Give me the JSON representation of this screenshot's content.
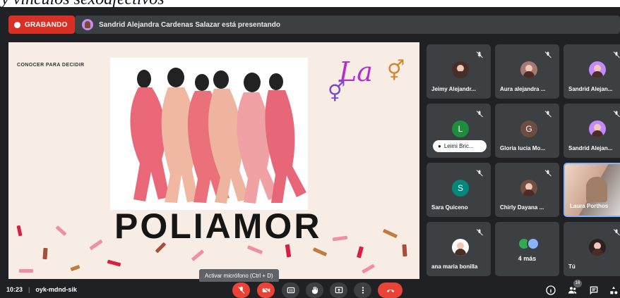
{
  "document": {
    "title": "y vinculos sexoafectivos"
  },
  "meeting": {
    "recording_label": "GRABANDO",
    "presenting_label": "Sandrid Alejandra Cardenas Salazar está presentando",
    "time": "10:23",
    "separator": "|",
    "code": "oyk-mdnd-sik",
    "tooltip": "Activar micrófono (Ctrl + D)",
    "participant_count": "16"
  },
  "slide": {
    "kicker": "CONOCER PARA DECIDIR",
    "title": "POLIAMOR",
    "script_word": "La",
    "symbol_1": "⚥",
    "symbol_2": "⚥"
  },
  "participants": [
    {
      "name": "Jeimy Alejandr...",
      "avatar": "photo",
      "muted": true
    },
    {
      "name": "Aura alejandra ...",
      "avatar": "photo",
      "muted": true
    },
    {
      "name": "Sandrid Alejan...",
      "avatar": "photo",
      "muted": true
    },
    {
      "initial": "L",
      "chip_label": "Leimi Bric...",
      "muted": true,
      "avatar_color": "#1e8e3e"
    },
    {
      "initial": "G",
      "name": "Gloria lucia Mo...",
      "muted": true,
      "avatar_color": "#6d4c41"
    },
    {
      "name": "Sandrid Alejan...",
      "avatar": "photo",
      "muted": true
    },
    {
      "initial": "S",
      "name": "Sara Quiceno",
      "muted": true,
      "avatar_color": "#00897b"
    },
    {
      "name": "Chirly Dayana ...",
      "avatar": "photo",
      "muted": true
    },
    {
      "name": "Laura Porthos",
      "view": "live",
      "selected": true
    },
    {
      "name": "ana maria bonilla",
      "avatar": "photo",
      "muted": true
    },
    {
      "name": "4 más",
      "avatar": "stack",
      "muted": false
    },
    {
      "name": "Tú",
      "avatar": "photo",
      "muted": true
    }
  ],
  "icons": {
    "mic_off": "mic-off-icon",
    "camera_off": "camera-off-icon",
    "captions": "captions-icon",
    "hand": "hand-icon",
    "present": "present-icon",
    "more": "more-icon",
    "end_call": "end-call-icon",
    "info": "info-icon",
    "people": "people-icon",
    "chat": "chat-icon",
    "activities": "activities-icon"
  },
  "colors": {
    "recording": "#d93025",
    "mic_off": "#ea4335",
    "end_call": "#ea4335",
    "meet_background": "#202124",
    "tile_background": "#3c4043"
  }
}
